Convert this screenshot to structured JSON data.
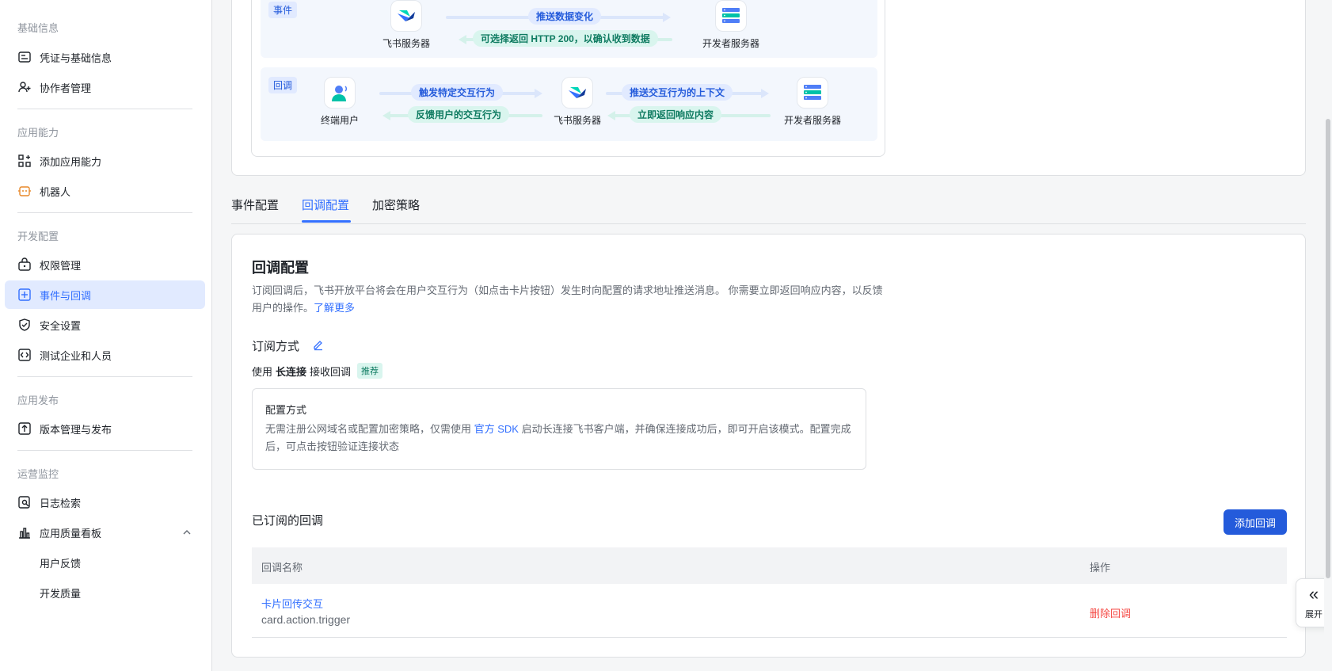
{
  "sidebar": {
    "groups": {
      "basic": "基础信息",
      "ability": "应用能力",
      "dev": "开发配置",
      "release": "应用发布",
      "ops": "运营监控"
    },
    "items": {
      "credentials": "凭证与基础信息",
      "collaborators": "协作者管理",
      "add_ability": "添加应用能力",
      "bot": "机器人",
      "permissions": "权限管理",
      "events": "事件与回调",
      "security": "安全设置",
      "test_tenant": "测试企业和人员",
      "versions": "版本管理与发布",
      "logs": "日志检索",
      "quality": "应用质量看板",
      "feedback": "用户反馈",
      "dev_quality": "开发质量"
    }
  },
  "flow": {
    "event_tag": "事件",
    "callback_tag": "回调",
    "feishu_server": "飞书服务器",
    "dev_server": "开发者服务器",
    "end_user": "终端用户",
    "push_data_change": "推送数据变化",
    "optional_return": "可选择返回 HTTP 200，以确认收到数据",
    "trigger_action": "触发特定交互行为",
    "feedback_action": "反馈用户的交互行为",
    "push_context": "推送交互行为的上下文",
    "return_response": "立即返回响应内容"
  },
  "tabs": [
    "事件配置",
    "回调配置",
    "加密策略"
  ],
  "main": {
    "title": "回调配置",
    "desc": "订阅回调后，飞书开放平台将会在用户交互行为（如点击卡片按钮）发生时向配置的请求地址推送消息。 你需要立即返回响应内容，以反馈用户的操作。",
    "learn_more": "了解更多",
    "sub_method": "订阅方式",
    "use_prefix": "使用",
    "use_bold": "长连接",
    "use_suffix": "接收回调",
    "recommended": "推荐",
    "config_title": "配置方式",
    "config_desc_1": "无需注册公网域名或配置加密策略，仅需使用",
    "config_link": "官方 SDK",
    "config_desc_2": "启动长连接飞书客户端，并确保连接成功后，即可开启该模式。配置完成后，可点击按钮验证连接状态",
    "subscribed_title": "已订阅的回调",
    "add_button": "添加回调",
    "table": {
      "col_name": "回调名称",
      "col_op": "操作",
      "rows": [
        {
          "name": "卡片回传交互",
          "key": "card.action.trigger",
          "op": "删除回调"
        }
      ]
    }
  },
  "expand_label": "展开",
  "colors": {
    "accent": "#3370ff",
    "primary_button": "#245bdb",
    "danger": "#f54a45",
    "active_bg": "#e1eaff"
  }
}
